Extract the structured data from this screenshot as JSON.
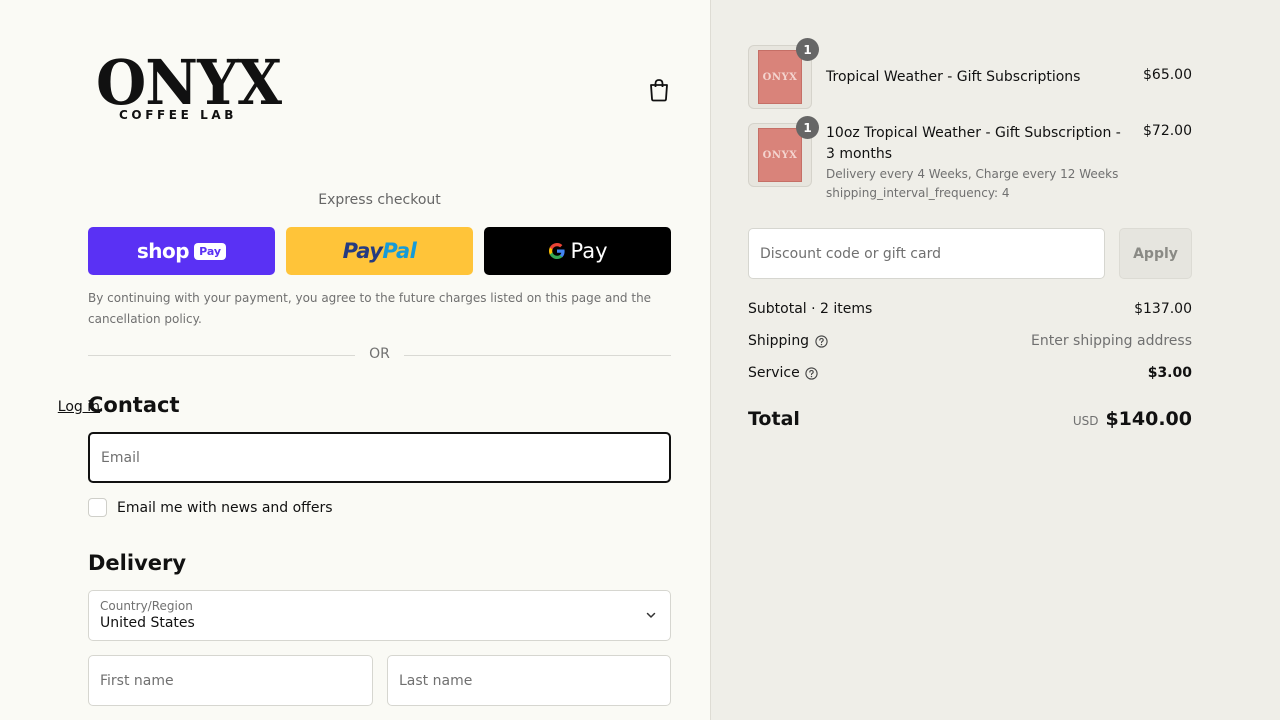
{
  "brand": {
    "name": "ONYX",
    "subtitle": "COFFEE LAB"
  },
  "express": {
    "title": "Express checkout",
    "shop_pay": {
      "word": "shop",
      "pill": "Pay"
    },
    "paypal": {
      "pay": "Pay",
      "pal": "Pal"
    },
    "gpay": {
      "word": "Pay"
    },
    "consent": "By continuing with your payment, you agree to the future charges listed on this page and the cancellation policy."
  },
  "divider": {
    "text": "OR"
  },
  "contact": {
    "heading": "Contact",
    "login": "Log in",
    "email_placeholder": "Email",
    "newsletter_label": "Email me with news and offers"
  },
  "delivery": {
    "heading": "Delivery",
    "country_label": "Country/Region",
    "country_value": "United States",
    "first_name_placeholder": "First name",
    "last_name_placeholder": "Last name"
  },
  "cart": {
    "items": [
      {
        "qty": "1",
        "title": "Tropical Weather - Gift Subscriptions",
        "price": "$65.00",
        "meta": []
      },
      {
        "qty": "1",
        "title": "10oz Tropical Weather - Gift Subscription - 3 months",
        "price": "$72.00",
        "meta": [
          "Delivery every 4 Weeks, Charge every 12 Weeks",
          "shipping_interval_frequency: 4"
        ]
      }
    ],
    "thumb_text": "ONYX",
    "discount_placeholder": "Discount code or gift card",
    "apply_label": "Apply"
  },
  "summary": {
    "subtotal_label": "Subtotal · 2 items",
    "subtotal_value": "$137.00",
    "shipping_label": "Shipping",
    "shipping_value": "Enter shipping address",
    "service_label": "Service",
    "service_value": "$3.00",
    "total_label": "Total",
    "total_currency": "USD",
    "total_value": "$140.00"
  },
  "colors": {
    "shop_pay": "#5a31f4",
    "paypal": "#ffc439",
    "gpay": "#000000",
    "summary_bg": "#efeee8",
    "page_bg": "#fafaf5"
  }
}
